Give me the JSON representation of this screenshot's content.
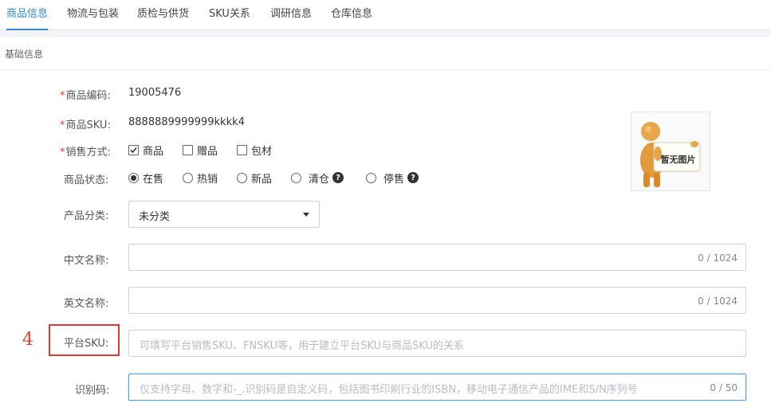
{
  "tabs": [
    {
      "label": "商品信息",
      "active": true
    },
    {
      "label": "物流与包装",
      "active": false
    },
    {
      "label": "质检与供货",
      "active": false
    },
    {
      "label": "SKU关系",
      "active": false
    },
    {
      "label": "调研信息",
      "active": false
    },
    {
      "label": "仓库信息",
      "active": false
    }
  ],
  "section_title": "基础信息",
  "fields": {
    "code": {
      "required": "*",
      "label": "商品编码:",
      "value": "19005476"
    },
    "sku": {
      "required": "*",
      "label": "商品SKU:",
      "value": "8888889999999kkkk4"
    },
    "sale_mode": {
      "required": "*",
      "label": "销售方式:",
      "options": [
        {
          "label": "商品",
          "checked": true
        },
        {
          "label": "赠品",
          "checked": false
        },
        {
          "label": "包材",
          "checked": false
        }
      ]
    },
    "status": {
      "label": "商品状态:",
      "options": [
        {
          "label": "在售",
          "selected": true
        },
        {
          "label": "热销",
          "selected": false
        },
        {
          "label": "新品",
          "selected": false
        },
        {
          "label": "清仓",
          "selected": false,
          "help": "?"
        },
        {
          "label": "停售",
          "selected": false,
          "help": "?"
        }
      ]
    },
    "category": {
      "label": "产品分类:",
      "value": "未分类"
    },
    "cn_name": {
      "label": "中文名称:",
      "value": "",
      "counter": "0 / 1024"
    },
    "en_name": {
      "label": "英文名称:",
      "value": "",
      "counter": "0 / 1024"
    },
    "platform_sku": {
      "label": "平台SKU:",
      "placeholder": "可填写平台销售SKU、FNSKU等，用于建立平台SKU与商品SKU的关系"
    },
    "ident_code": {
      "label": "识别码:",
      "placeholder": "仅支持字母、数字和-_.识别码是自定义码，包括图书印刷行业的ISBN，移动电子通信产品的IME和S/N序列号",
      "counter": "0 / 50"
    }
  },
  "annotation": {
    "marker": "4",
    "color": "#e53935"
  },
  "image_placeholder": {
    "text": "暂无图片",
    "icon": "no-image-figure-icon"
  },
  "colors": {
    "accent": "#2f8ad8",
    "required": "#e53935",
    "border": "#cfd3d8",
    "focus": "#4a9fe8"
  }
}
